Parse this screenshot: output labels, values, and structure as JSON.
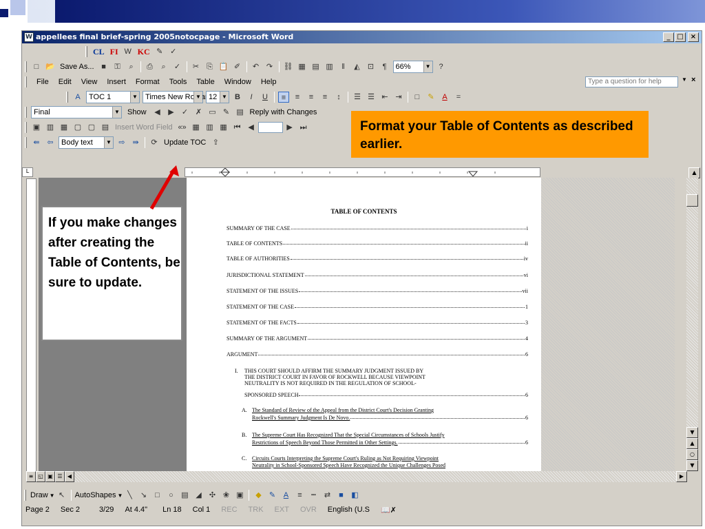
{
  "window": {
    "title": "appellees final brief-spring 2005notocpage - Microsoft Word",
    "min_label": "_",
    "max_label": "□",
    "close_label": "×"
  },
  "toolbars": {
    "citation_row": [
      "CL",
      "FI",
      "KC"
    ],
    "standard": {
      "save_as_label": "Save As...",
      "zoom_value": "66%"
    },
    "menu": [
      "File",
      "Edit",
      "View",
      "Insert",
      "Format",
      "Tools",
      "Table",
      "Window",
      "Help"
    ],
    "help_placeholder": "Type a question for help",
    "formatting": {
      "style": "TOC 1",
      "font": "Times New Roman",
      "size": "12"
    },
    "reviewing": {
      "display": "Final",
      "show_label": "Show",
      "reply_label": "Reply with Changes"
    },
    "mailmerge": {
      "insert_word_field": "Insert Word Field"
    },
    "outlining": {
      "level": "Body text",
      "update_toc": "Update TOC"
    }
  },
  "callouts": {
    "top": "Format your Table of Contents as described earlier.",
    "left": "If you make changes after creating the Table of Contents, be sure to update."
  },
  "document": {
    "heading": "TABLE OF CONTENTS",
    "entries": [
      {
        "label": "SUMMARY OF THE CASE",
        "page": "i"
      },
      {
        "label": "TABLE OF CONTENTS",
        "page": "ii"
      },
      {
        "label": "TABLE OF AUTHORITIES",
        "page": "iv"
      },
      {
        "label": "JURISDICTIONAL STATEMENT",
        "page": "vi"
      },
      {
        "label": "STATEMENT OF THE ISSUES",
        "page": "vii"
      },
      {
        "label": "STATEMENT OF THE CASE",
        "page": "1"
      },
      {
        "label": "STATEMENT OF THE FACTS",
        "page": "3"
      },
      {
        "label": "SUMMARY OF THE ARGUMENT",
        "page": "4"
      },
      {
        "label": "ARGUMENT",
        "page": "6"
      }
    ],
    "section_i": {
      "num": "I.",
      "lines": [
        "THIS COURT SHOULD AFFIRM THE SUMMARY JUDGMENT ISSUED BY",
        "THE DISTRICT COURT IN FAVOR OF ROCKWELL BECAUSE VIEWPOINT",
        "NEUTRALITY IS NOT REQUIRED IN THE REGULATION OF SCHOOL-",
        "SPONSORED SPEECH"
      ],
      "page": "6"
    },
    "sub_a": {
      "num": "A.",
      "lines": [
        "The Standard of Review of the Appeal from the District Court's Decision Granting",
        "Rockwell's Summary Judgment Is De Novo."
      ],
      "page": "6"
    },
    "sub_b": {
      "num": "B.",
      "lines": [
        "The Supreme Court Has Recognized That the Special Circumstances of Schools Justify",
        "Restrictions of Speech Beyond Those Permitted in Other Settings."
      ],
      "page": "6"
    },
    "sub_c": {
      "num": "C.",
      "lines": [
        "Circuits Courts Interpreting the Supreme Court's Ruling as Not Requiring Viewpoint",
        "Neutrality in School-Sponsored Speech Have Recognized the Unique Challenges Posed"
      ]
    }
  },
  "drawbar": {
    "draw_label": "Draw",
    "autoshapes_label": "AutoShapes"
  },
  "status": {
    "page": "Page 2",
    "sec": "Sec 2",
    "of": "3/29",
    "at": "At 4.4\"",
    "ln": "Ln 18",
    "col": "Col 1",
    "rec": "REC",
    "trk": "TRK",
    "ext": "EXT",
    "ovr": "OVR",
    "lang": "English (U.S"
  }
}
